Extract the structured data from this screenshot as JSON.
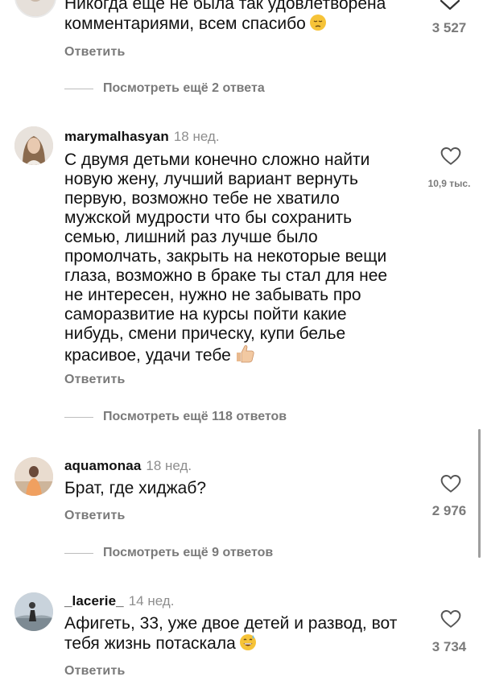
{
  "comments": [
    {
      "text_line1": "Никогда еще не была так удовлетворена",
      "text_line2": "комментариями, всем спасибо",
      "likes": "3 527",
      "reply_label": "Ответить",
      "view_more": "Посмотреть ещё 2 ответа"
    },
    {
      "username": "marymalhasyan",
      "time": "18 нед.",
      "text_lines": [
        "С двумя детьми конечно сложно найти",
        "новую жену, лучший вариант вернуть",
        "первую, возможно тебе не хватило",
        "мужской мудрости что бы сохранить",
        "семью, лишний раз лучше было",
        "промолчать, закрыть на некоторые вещи",
        "глаза, возможно в браке ты стал для нее",
        "не интересен, нужно не забывать про",
        "саморазвитие на курсы пойти какие",
        "нибудь, смени прическу, купи белье",
        "красивое, удачи тебе"
      ],
      "likes": "10,9 тыс.",
      "reply_label": "Ответить",
      "view_more": "Посмотреть ещё 118 ответов"
    },
    {
      "username": "aquamonaa",
      "time": "18 нед.",
      "text": "Брат, где хиджаб?",
      "likes": "2 976",
      "reply_label": "Ответить",
      "view_more": "Посмотреть ещё 9 ответов"
    },
    {
      "username": "_lacerie_",
      "time": "14 нед.",
      "text_line1": "Афигеть, 33, уже двое детей и развод, вот",
      "text_line2": "тебя жизнь потаскала",
      "likes": "3 734",
      "reply_label": "Ответить"
    }
  ],
  "icons": {
    "heart": "heart-outline-icon",
    "chevron": "chevron-down-icon",
    "emoji_pensive": "pensive-face-emoji",
    "emoji_thumbs": "thumbs-up-emoji",
    "emoji_sweat": "grinning-sweat-emoji"
  },
  "colors": {
    "text": "#111111",
    "secondary": "#7a7a7a",
    "background": "#ffffff"
  }
}
